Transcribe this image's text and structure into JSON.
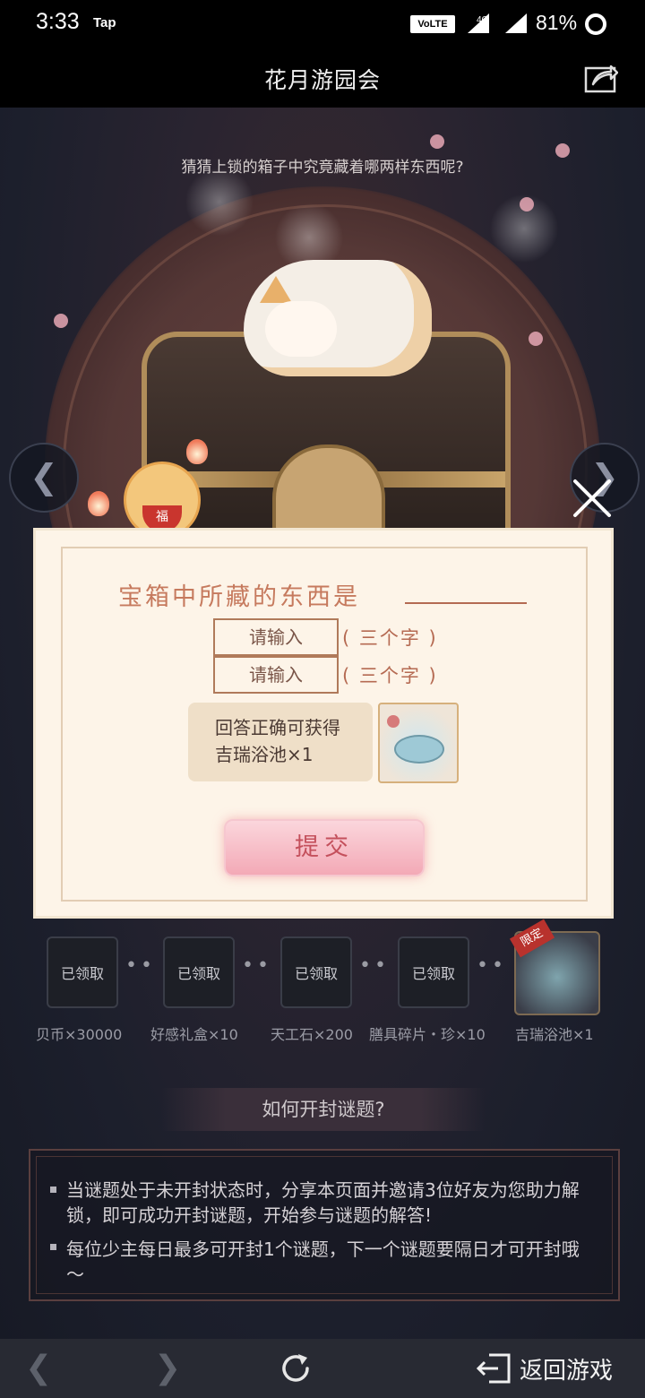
{
  "status_bar": {
    "time": "3:33",
    "app_indicator": "Tap",
    "volte": "VoLTE",
    "network": "4G",
    "battery": "81%"
  },
  "header": {
    "title": "花月游园会",
    "share_icon": "share-icon"
  },
  "event": {
    "question": "猜猜上锁的箱子中究竟藏着哪两样东西呢?"
  },
  "modal": {
    "prompt": "宝箱中所藏的东西是",
    "input1_placeholder": "请输入",
    "input2_placeholder": "请输入",
    "hint1": "( 三个字 )",
    "hint2": "( 三个字 )",
    "reward_line1": "回答正确可获得",
    "reward_line2": "吉瑞浴池×1",
    "submit_label": "提交"
  },
  "progress": {
    "items": [
      {
        "status": "已领取",
        "label": "贝币×30000"
      },
      {
        "status": "已领取",
        "label": "好感礼盒×10"
      },
      {
        "status": "已领取",
        "label": "天工石×200"
      },
      {
        "status": "已领取",
        "label": "膳具碎片・珍×10"
      },
      {
        "status": "",
        "badge": "限定",
        "label": "吉瑞浴池×1"
      }
    ],
    "separator": "••"
  },
  "howto": {
    "title": "如何开封谜题?",
    "rules": [
      "当谜题处于未开封状态时，分享本页面并邀请3位好友为您助力解锁，即可成功开封谜题，开始参与谜题的解答!",
      "每位少主每日最多可开封1个谜题，下一个谜题要隔日才可开封哦～"
    ]
  },
  "bottom_bar": {
    "return_label": "返回游戏"
  }
}
